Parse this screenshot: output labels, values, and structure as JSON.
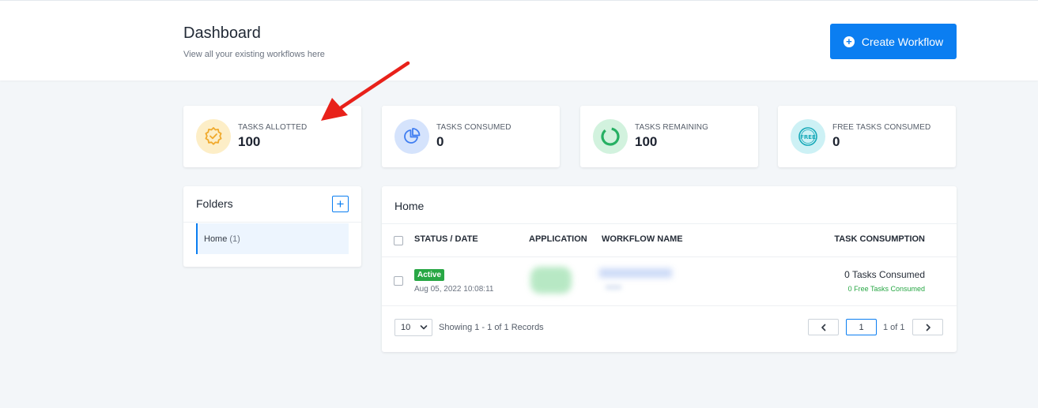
{
  "header": {
    "title": "Dashboard",
    "subtitle": "View all your existing workflows here",
    "create_button": "Create Workflow"
  },
  "stats": [
    {
      "label": "TASKS ALLOTTED",
      "value": "100",
      "icon": "verified-badge-icon",
      "color": "#f0a92b"
    },
    {
      "label": "TASKS CONSUMED",
      "value": "0",
      "icon": "pie-chart-icon",
      "color": "#3f7df1"
    },
    {
      "label": "TASKS REMAINING",
      "value": "100",
      "icon": "ring-progress-icon",
      "color": "#26b063"
    },
    {
      "label": "FREE TASKS CONSUMED",
      "value": "0",
      "icon": "free-stamp-icon",
      "color": "#16a9b8"
    }
  ],
  "folders": {
    "title": "Folders",
    "items": [
      {
        "name": "Home",
        "count": "(1)"
      }
    ]
  },
  "home": {
    "title": "Home",
    "columns": [
      "STATUS / DATE",
      "APPLICATION",
      "WORKFLOW NAME",
      "TASK CONSUMPTION"
    ],
    "rows": [
      {
        "status": "Active",
        "date": "Aug 05, 2022 10:08:11",
        "tasks": "0 Tasks Consumed",
        "free_tasks": "0 Free Tasks Consumed"
      }
    ],
    "page_size": "10",
    "showing": "Showing 1 - 1 of 1 Records",
    "page": "1",
    "page_of": "1 of 1"
  },
  "colors": {
    "accent": "#0b7ef1",
    "active_green": "#28a745",
    "annotation_red": "#e8211a"
  }
}
